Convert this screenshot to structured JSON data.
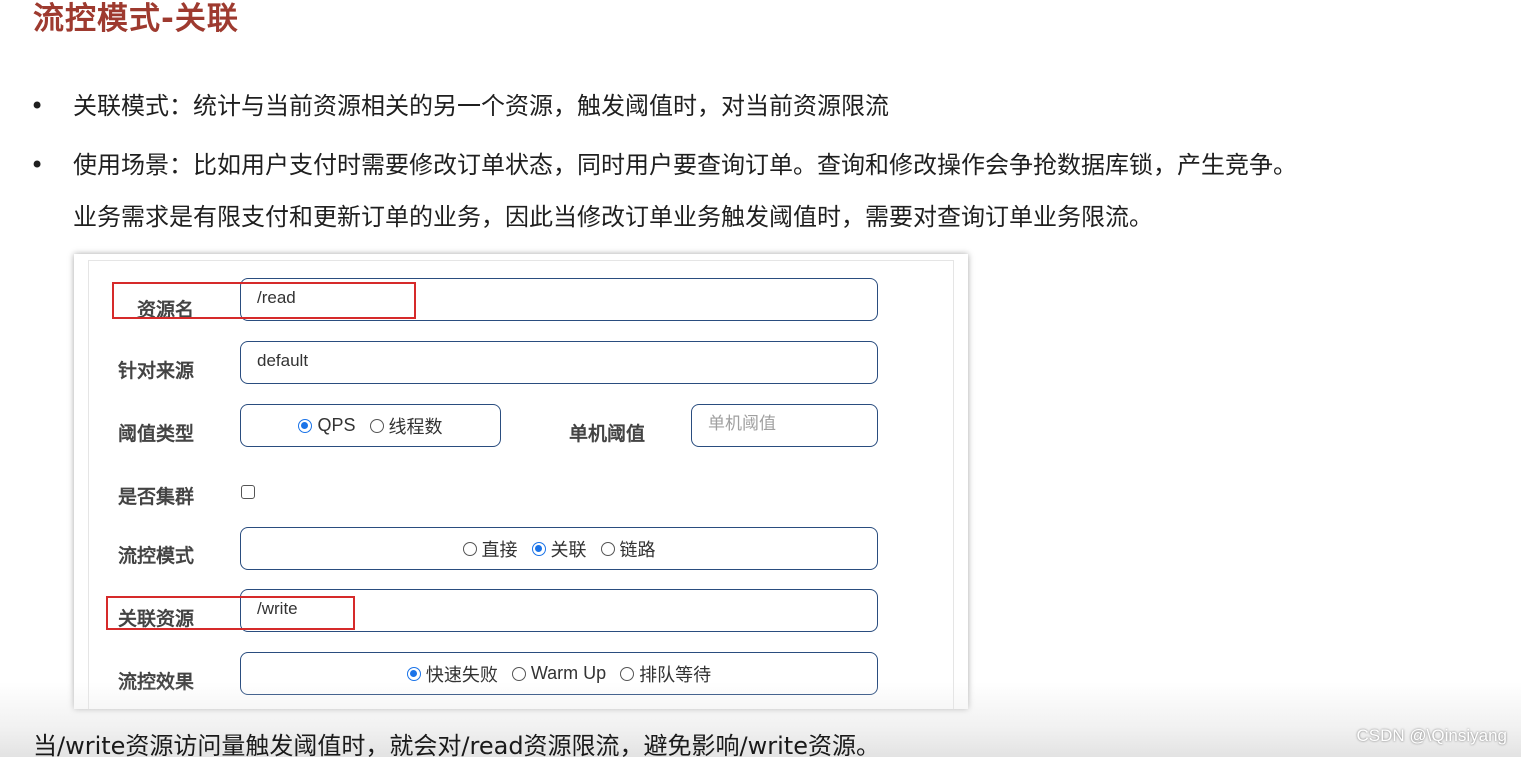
{
  "title": "流控模式-关联",
  "bullets": [
    {
      "symbol": "•",
      "text": "关联模式：统计与当前资源相关的另一个资源，触发阈值时，对当前资源限流"
    },
    {
      "symbol": "•",
      "text": "使用场景：比如用户支付时需要修改订单状态，同时用户要查询订单。查询和修改操作会争抢数据库锁，产生竞争。",
      "continuation": "业务需求是有限支付和更新订单的业务，因此当修改订单业务触发阈值时，需要对查询订单业务限流。"
    }
  ],
  "form": {
    "resource": {
      "label": "资源名",
      "value": "/read"
    },
    "origin": {
      "label": "针对来源",
      "value": "default"
    },
    "threshold_type": {
      "label": "阈值类型",
      "options": [
        {
          "label": "QPS",
          "checked": true
        },
        {
          "label": "线程数",
          "checked": false
        }
      ]
    },
    "single_threshold": {
      "label": "单机阈值",
      "placeholder": "单机阈值"
    },
    "cluster": {
      "label": "是否集群",
      "checked": false
    },
    "flow_mode": {
      "label": "流控模式",
      "options": [
        {
          "label": "直接",
          "checked": false
        },
        {
          "label": "关联",
          "checked": true
        },
        {
          "label": "链路",
          "checked": false
        }
      ]
    },
    "ref_resource": {
      "label": "关联资源",
      "value": "/write"
    },
    "flow_effect": {
      "label": "流控效果",
      "options": [
        {
          "label": "快速失败",
          "checked": true
        },
        {
          "label": "Warm Up",
          "checked": false
        },
        {
          "label": "排队等待",
          "checked": false
        }
      ]
    }
  },
  "footer": "当/write资源访问量触发阈值时，就会对/read资源限流，避免影响/write资源。",
  "watermark": "CSDN @\\Qinsiyang",
  "colors": {
    "title": "#9e3a2f",
    "highlight": "#d62a2a",
    "radio_on": "#1a73e8",
    "box_border": "#2a4d7f"
  }
}
